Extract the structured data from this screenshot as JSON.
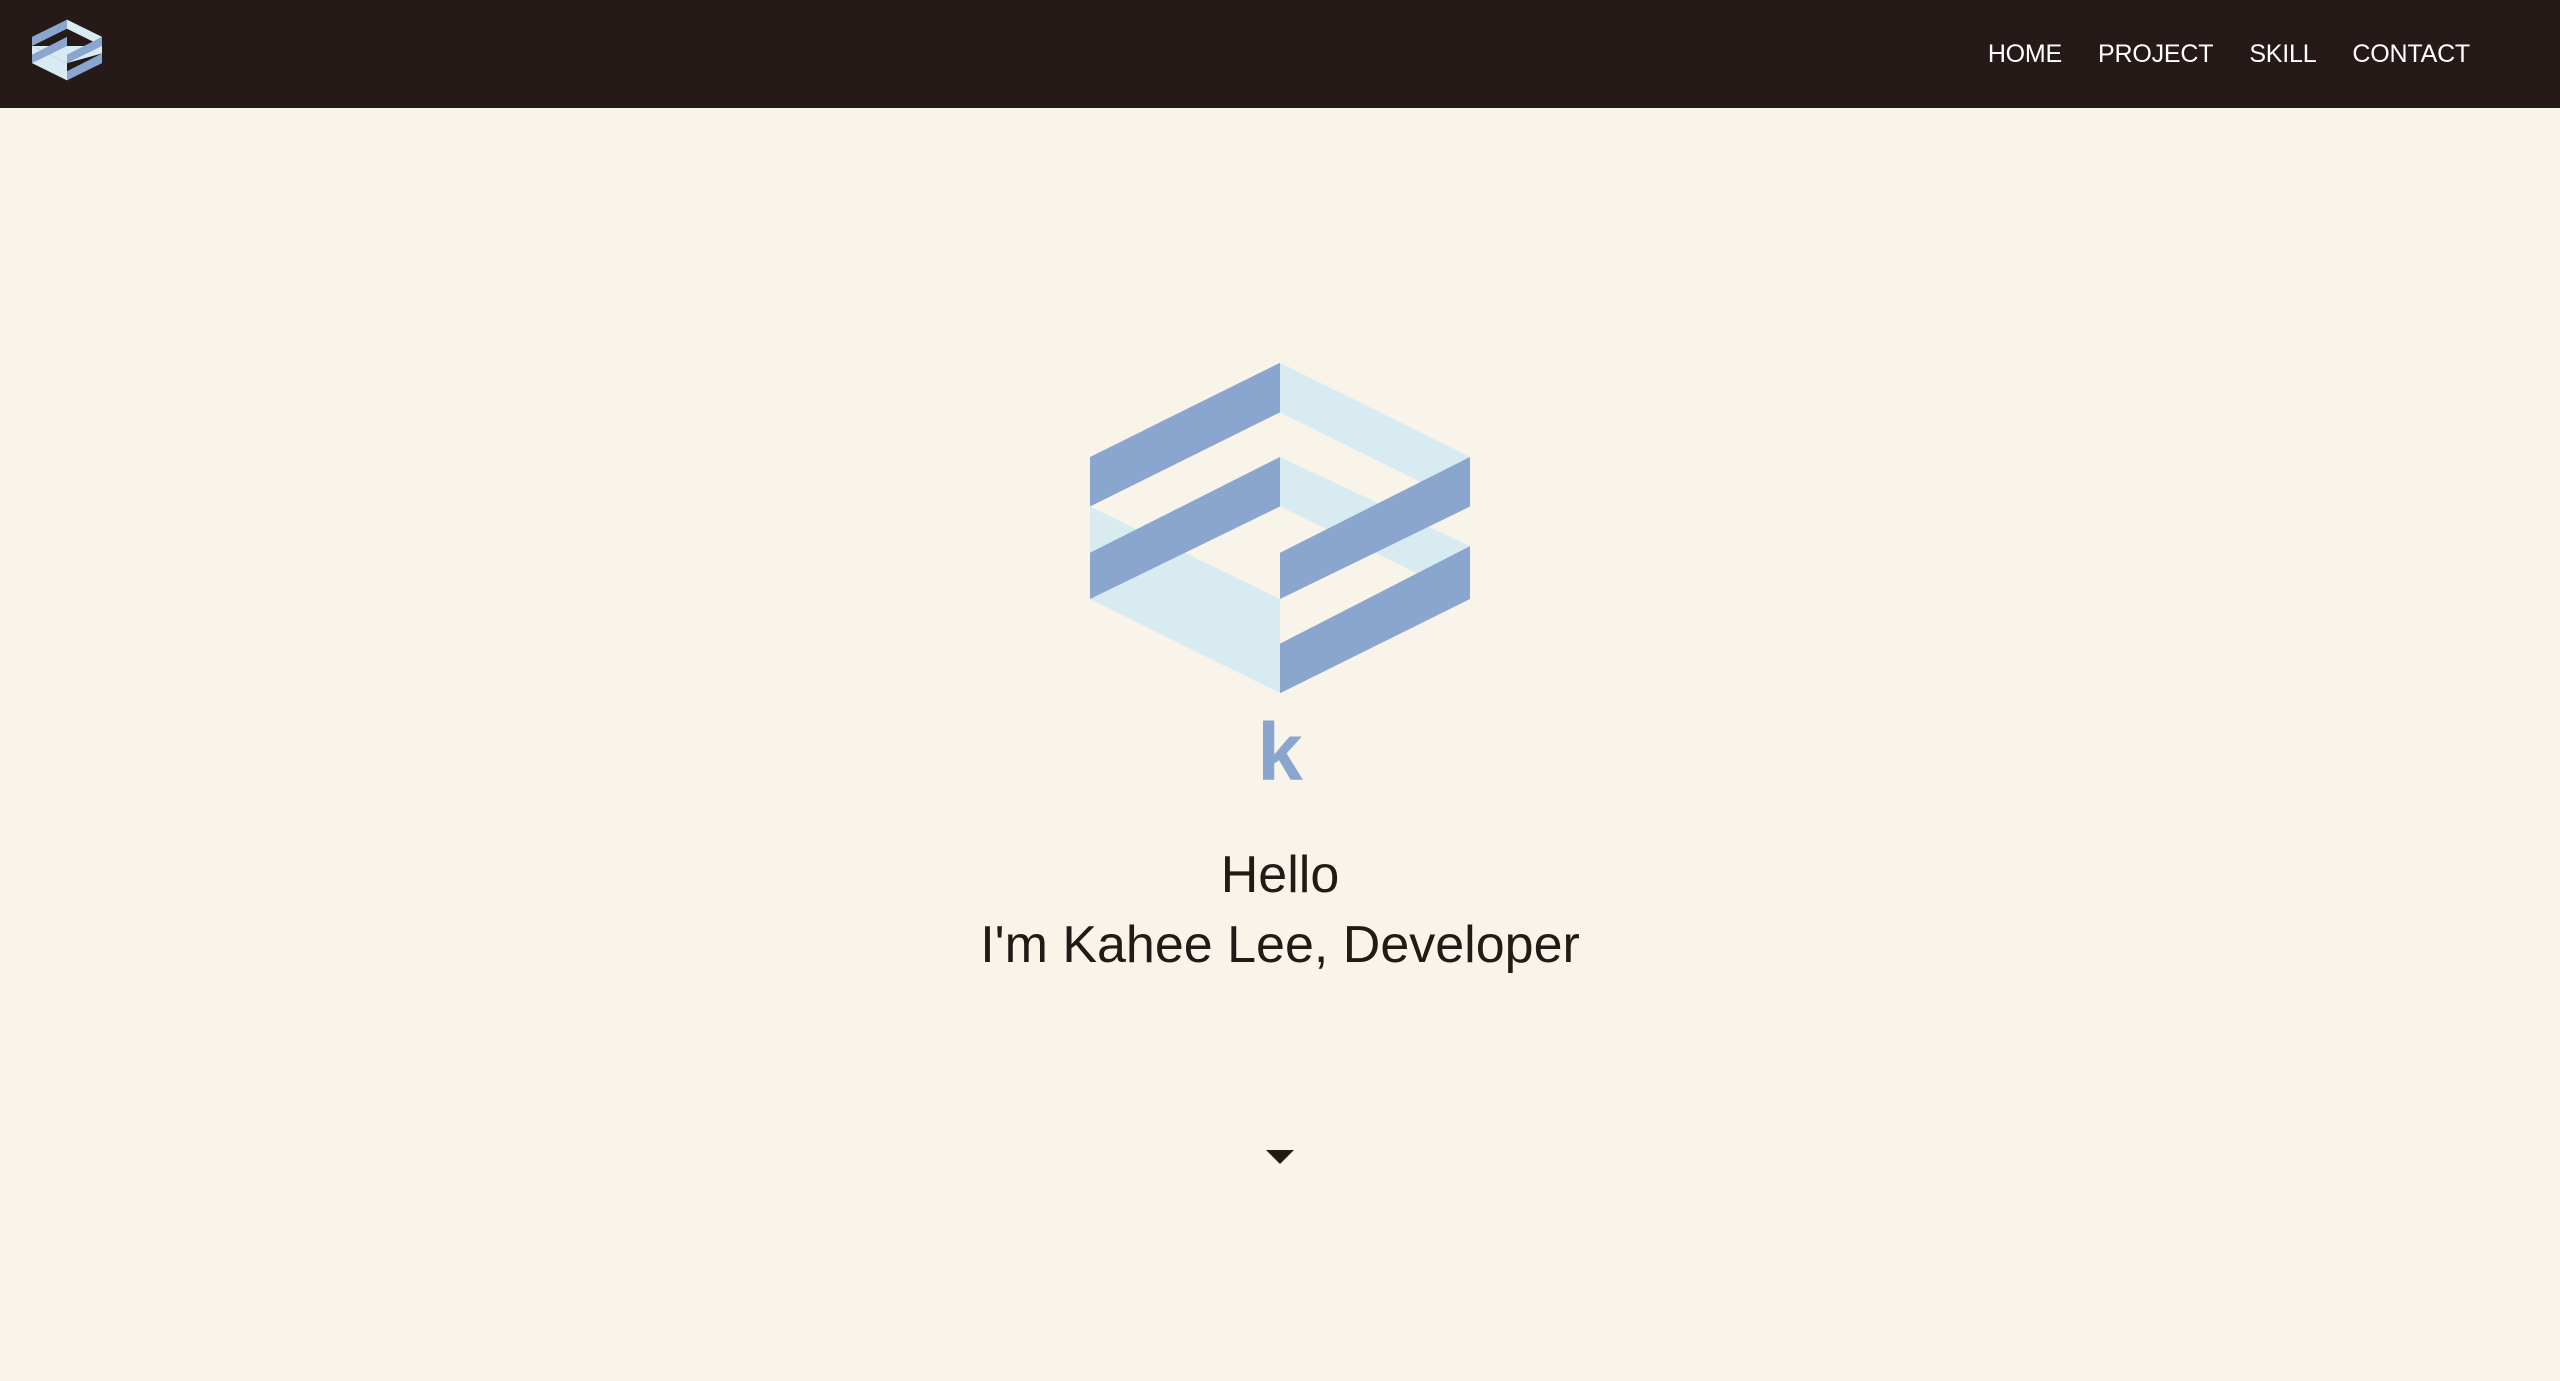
{
  "navbar": {
    "logo_icon": "hex-stack-logo-icon",
    "links": [
      "HOME",
      "PROJECT",
      "SKILL",
      "CONTACT"
    ]
  },
  "hero": {
    "logo_icon": "hex-stack-logo-icon",
    "initial": "k",
    "greeting": "Hello",
    "intro": "I'm Kahee Lee, Developer",
    "scroll_icon": "caret-down-icon"
  },
  "colors": {
    "navbar_bg": "#261a18",
    "page_bg": "#f9f4ea",
    "logo_dark": "#8aa5ce",
    "logo_light": "#d8ebf1",
    "text": "#231a18"
  }
}
